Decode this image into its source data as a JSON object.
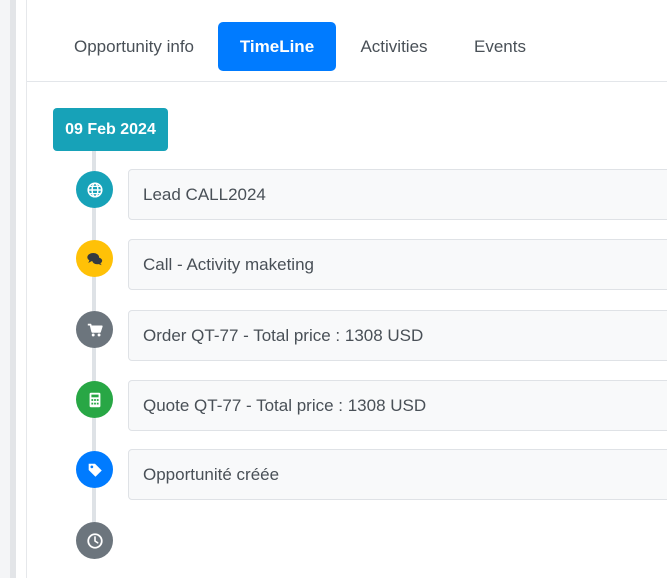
{
  "tabs": [
    {
      "label": "Opportunity info",
      "active": false
    },
    {
      "label": "TimeLine",
      "active": true
    },
    {
      "label": "Activities",
      "active": false
    },
    {
      "label": "Events",
      "active": false
    }
  ],
  "timeline": {
    "date": "09 Feb 2024",
    "items": [
      {
        "icon": "globe-icon",
        "color": "#17a2b8",
        "text": "Lead CALL2024"
      },
      {
        "icon": "comments-icon",
        "color": "#ffc107",
        "text": "Call - Activity maketing"
      },
      {
        "icon": "shopping-cart-icon",
        "color": "#6c757d",
        "text": "Order QT-77 - Total price : 1308 USD"
      },
      {
        "icon": "calculator-icon",
        "color": "#28a745",
        "text": "Quote QT-77 - Total price : 1308 USD"
      },
      {
        "icon": "tag-icon",
        "color": "#007bff",
        "text": "Opportunité créée"
      }
    ],
    "end_icon": {
      "icon": "clock-icon",
      "color": "#6c757d"
    }
  },
  "colors": {
    "accent": "#007bff",
    "date_badge": "#17a2b8"
  }
}
